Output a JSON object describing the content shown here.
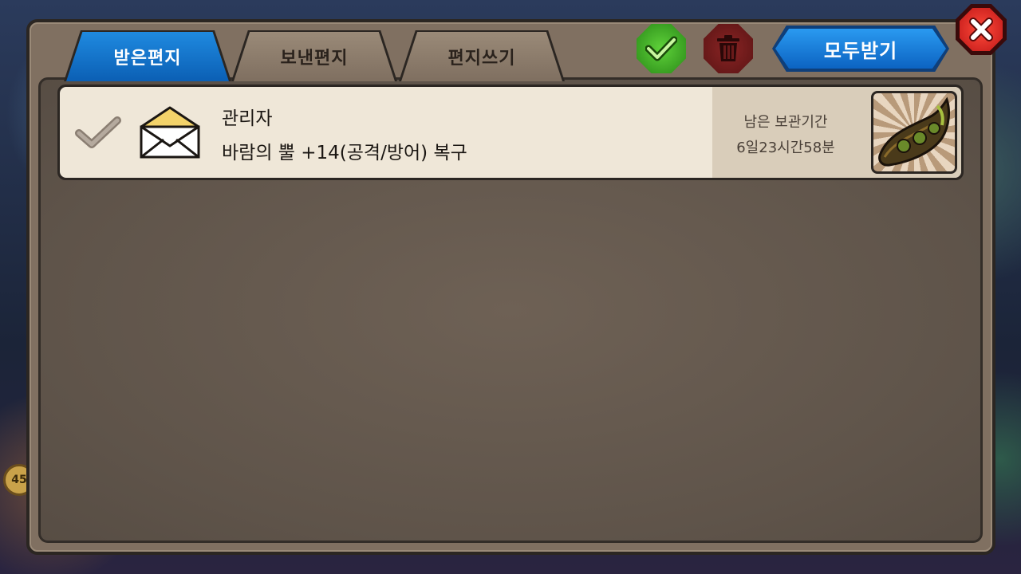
{
  "tabs": [
    {
      "label": "받은편지",
      "active": true
    },
    {
      "label": "보낸편지",
      "active": false
    },
    {
      "label": "편지쓰기",
      "active": false
    }
  ],
  "toolbar": {
    "select_all_icon": "check-icon",
    "delete_icon": "trash-icon",
    "receive_all_label": "모두받기",
    "close_icon": "close-icon"
  },
  "mails": [
    {
      "sender": "관리자",
      "subject": "바람의 뿔 +14(공격/방어) 복구",
      "keep_label": "남은 보관기간",
      "keep_value": "6일23시간58분",
      "attachment_icon": "horn-item-icon",
      "envelope_icon": "opened-envelope-icon"
    }
  ],
  "background": {
    "coin_text": "45"
  },
  "colors": {
    "active_tab": "#0b5fb4",
    "inactive_tab": "#8a7a68",
    "check_button": "#3aa821",
    "trash_button": "#6a1a1a",
    "receive_all_button": "#0c63c2",
    "close_button": "#d42020",
    "panel": "#62574c",
    "mail_item": "#efe7d8"
  }
}
